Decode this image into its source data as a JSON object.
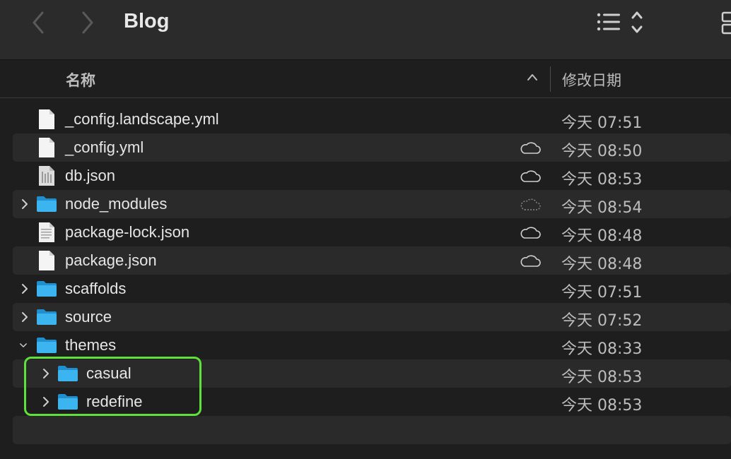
{
  "window": {
    "title": "Blog",
    "back_icon": "chevron-left-icon",
    "forward_icon": "chevron-right-icon",
    "view_icon": "list-view-icon"
  },
  "columns": {
    "name": "名称",
    "date_modified": "修改日期",
    "sort_icon": "chevron-up-icon"
  },
  "rows": [
    {
      "name": "_config.landscape.yml",
      "kind": "file",
      "date": "今天 07:51",
      "cloud": "none"
    },
    {
      "name": "_config.yml",
      "kind": "file",
      "date": "今天 08:50",
      "cloud": "cloud"
    },
    {
      "name": "db.json",
      "kind": "data-file",
      "date": "今天 08:53",
      "cloud": "cloud"
    },
    {
      "name": "node_modules",
      "kind": "folder",
      "date": "今天 08:54",
      "cloud": "cloud-dashed"
    },
    {
      "name": "package-lock.json",
      "kind": "data-file",
      "date": "今天 08:48",
      "cloud": "cloud"
    },
    {
      "name": "package.json",
      "kind": "file",
      "date": "今天 08:48",
      "cloud": "cloud"
    },
    {
      "name": "scaffolds",
      "kind": "folder",
      "date": "今天 07:51",
      "cloud": "none"
    },
    {
      "name": "source",
      "kind": "folder",
      "date": "今天 07:52",
      "cloud": "none"
    },
    {
      "name": "themes",
      "kind": "folder-expanded",
      "date": "今天 08:33",
      "cloud": "none"
    },
    {
      "name": "casual",
      "kind": "folder",
      "date": "今天 08:53",
      "cloud": "none",
      "depth": 1
    },
    {
      "name": "redefine",
      "kind": "folder",
      "date": "今天 08:53",
      "cloud": "none",
      "depth": 1
    }
  ],
  "colors": {
    "background": "#1e1e1e",
    "toolbar": "#2b2b2b",
    "alt_row": "#2a2a2a",
    "folder_blue": "#2aa6e8",
    "highlight_green": "#5fe03a"
  }
}
